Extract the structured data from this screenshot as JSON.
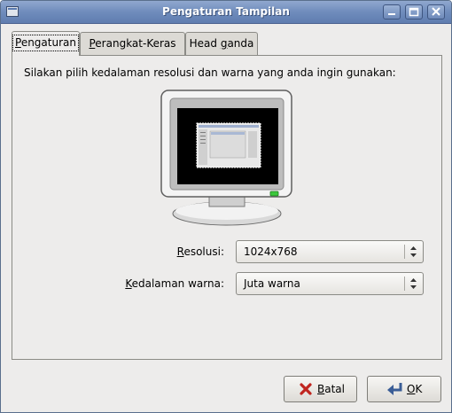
{
  "window": {
    "title": "Pengaturan Tampilan"
  },
  "tabs": [
    {
      "label_first": "P",
      "label_rest": "engaturan",
      "active": true
    },
    {
      "label_first": "P",
      "label_rest": "erangkat-Keras",
      "active": false
    },
    {
      "label_pre": "Head ",
      "label_first": "g",
      "label_rest": "anda",
      "active": false
    }
  ],
  "main": {
    "intro": "Silakan pilih kedalaman resolusi dan warna yang anda ingin gunakan:"
  },
  "form": {
    "resolution_label_first": "R",
    "resolution_label_rest": "esolusi:",
    "resolution_value": "1024x768",
    "depth_label_first": "K",
    "depth_label_rest": "edalaman warna:",
    "depth_value": "Juta warna"
  },
  "buttons": {
    "cancel_label_first": "B",
    "cancel_label_rest": "atal",
    "ok_label_first": "O",
    "ok_label_rest": "K"
  },
  "colors": {
    "titlebar": "#6f8cbc",
    "window_bg": "#edeceb",
    "screen_bg": "#000000",
    "power_led": "#3cc83c"
  },
  "icons": [
    "window-menu-icon",
    "minimize-icon",
    "maximize-icon",
    "close-icon",
    "monitor-icon",
    "cancel-x-icon",
    "ok-return-icon",
    "spinner-arrows-icon"
  ]
}
